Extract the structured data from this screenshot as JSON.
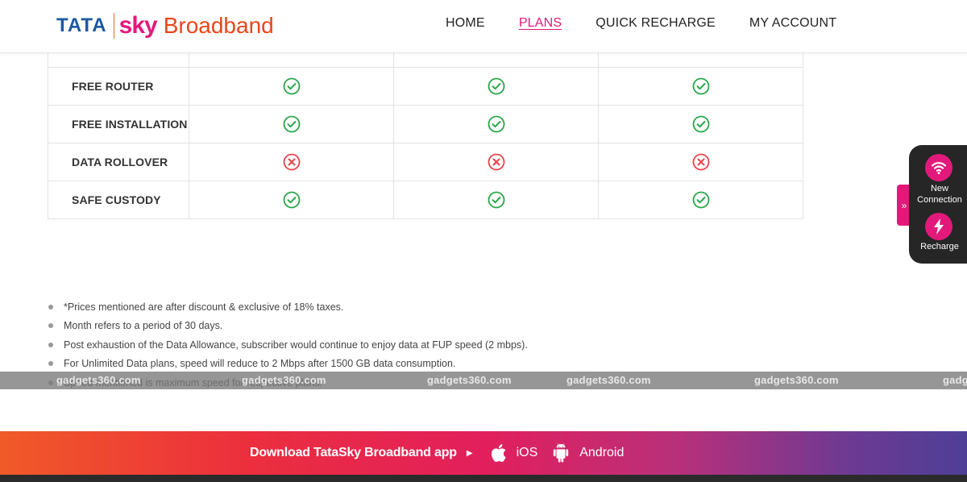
{
  "brand": {
    "tata": "TATA",
    "sky": "sky",
    "broadband": "Broadband"
  },
  "nav": [
    {
      "label": "HOME",
      "active": false
    },
    {
      "label": "PLANS",
      "active": true
    },
    {
      "label": "QUICK RECHARGE",
      "active": false
    },
    {
      "label": "MY ACCOUNT",
      "active": false
    }
  ],
  "features": [
    {
      "label": "FREE ROUTER",
      "values": [
        "yes",
        "yes",
        "yes"
      ]
    },
    {
      "label": "FREE INSTALLATION",
      "values": [
        "yes",
        "yes",
        "yes"
      ]
    },
    {
      "label": "DATA ROLLOVER",
      "values": [
        "no",
        "no",
        "no"
      ]
    },
    {
      "label": "SAFE CUSTODY",
      "values": [
        "yes",
        "yes",
        "yes"
      ]
    }
  ],
  "notes": [
    "*Prices mentioned are after discount & exclusive of 18% taxes.",
    "Month refers to a period of 30 days.",
    "Post exhaustion of the Data Allowance, subscriber would continue to enjoy data at FUP speed (2 mbps).",
    "For Unlimited Data plans, speed will reduce to 2 Mbps after 1500 GB data consumption.",
    "Speed mentioned is maximum speed for respective plans."
  ],
  "watermark": {
    "text": "gadgets360.com",
    "partial": "gadg"
  },
  "banner": {
    "title": "Download TataSky Broadband app",
    "ios": "iOS",
    "android": "Android"
  },
  "side_widget": {
    "toggle": "»",
    "new_line1": "New",
    "new_line2": "Connection",
    "recharge": "Recharge"
  },
  "colors": {
    "brand_blue": "#1b58a4",
    "brand_pink": "#e2197b",
    "brand_orange": "#e8461b",
    "check_green": "#2aa64a",
    "cross_red": "#e8434a"
  }
}
